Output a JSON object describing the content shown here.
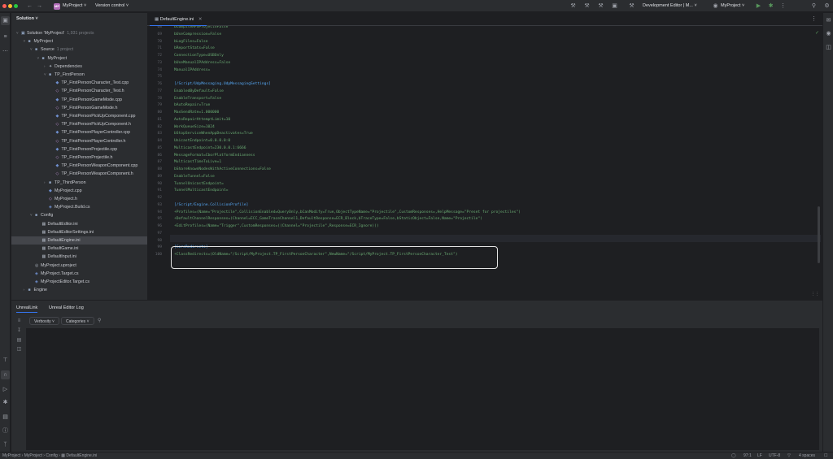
{
  "titlebar": {
    "project_badge": "MP",
    "project_name": "MyProject",
    "version_control": "Version control",
    "run_config": "Development Editor | M...",
    "target_project": "MyProject",
    "icons": [
      "back-icon",
      "forward-icon",
      "build-icon",
      "run-icon",
      "debug-icon",
      "more-icon",
      "search-icon",
      "settings-icon"
    ]
  },
  "solution": {
    "title": "Solution",
    "rows": [
      {
        "label": "Solution 'MyProject'",
        "hint": "1,931 projects",
        "depth": 0,
        "type": "sln",
        "expanded": true
      },
      {
        "label": "MyProject",
        "hint": "",
        "depth": 1,
        "type": "folder",
        "expanded": true
      },
      {
        "label": "Source",
        "hint": "1 project",
        "depth": 2,
        "type": "folder",
        "expanded": true
      },
      {
        "label": "MyProject",
        "hint": "",
        "depth": 3,
        "type": "folder",
        "expanded": true
      },
      {
        "label": "Dependencies",
        "hint": "",
        "depth": 4,
        "type": "deps",
        "expanded": false
      },
      {
        "label": "TP_FirstPerson",
        "hint": "",
        "depth": 4,
        "type": "folder",
        "expanded": true
      },
      {
        "label": "TP_FirstPersonCharacter_Test.cpp",
        "hint": "",
        "depth": 5,
        "type": "cpp"
      },
      {
        "label": "TP_FirstPersonCharacter_Test.h",
        "hint": "",
        "depth": 5,
        "type": "h"
      },
      {
        "label": "TP_FirstPersonGameMode.cpp",
        "hint": "",
        "depth": 5,
        "type": "cpp"
      },
      {
        "label": "TP_FirstPersonGameMode.h",
        "hint": "",
        "depth": 5,
        "type": "h"
      },
      {
        "label": "TP_FirstPersonPickUpComponent.cpp",
        "hint": "",
        "depth": 5,
        "type": "cpp"
      },
      {
        "label": "TP_FirstPersonPickUpComponent.h",
        "hint": "",
        "depth": 5,
        "type": "h"
      },
      {
        "label": "TP_FirstPersonPlayerController.cpp",
        "hint": "",
        "depth": 5,
        "type": "cpp"
      },
      {
        "label": "TP_FirstPersonPlayerController.h",
        "hint": "",
        "depth": 5,
        "type": "h"
      },
      {
        "label": "TP_FirstPersonProjectile.cpp",
        "hint": "",
        "depth": 5,
        "type": "cpp"
      },
      {
        "label": "TP_FirstPersonProjectile.h",
        "hint": "",
        "depth": 5,
        "type": "h"
      },
      {
        "label": "TP_FirstPersonWeaponComponent.cpp",
        "hint": "",
        "depth": 5,
        "type": "cpp"
      },
      {
        "label": "TP_FirstPersonWeaponComponent.h",
        "hint": "",
        "depth": 5,
        "type": "h"
      },
      {
        "label": "TP_ThirdPerson",
        "hint": "",
        "depth": 4,
        "type": "folder",
        "expanded": false
      },
      {
        "label": "MyProject.cpp",
        "hint": "",
        "depth": 4,
        "type": "cpp"
      },
      {
        "label": "MyProject.h",
        "hint": "",
        "depth": 4,
        "type": "h"
      },
      {
        "label": "MyProject.Build.cs",
        "hint": "",
        "depth": 4,
        "type": "cs"
      },
      {
        "label": "Config",
        "hint": "",
        "depth": 2,
        "type": "folder",
        "expanded": true
      },
      {
        "label": "DefaultEditor.ini",
        "hint": "",
        "depth": 3,
        "type": "ini"
      },
      {
        "label": "DefaultEditorSettings.ini",
        "hint": "",
        "depth": 3,
        "type": "ini"
      },
      {
        "label": "DefaultEngine.ini",
        "hint": "",
        "depth": 3,
        "type": "ini",
        "selected": true
      },
      {
        "label": "DefaultGame.ini",
        "hint": "",
        "depth": 3,
        "type": "ini"
      },
      {
        "label": "DefaultInput.ini",
        "hint": "",
        "depth": 3,
        "type": "ini"
      },
      {
        "label": "MyProject.uproject",
        "hint": "",
        "depth": 2,
        "type": "uproject"
      },
      {
        "label": "MyProject.Target.cs",
        "hint": "",
        "depth": 2,
        "type": "cs"
      },
      {
        "label": "MyProjectEditor.Target.cs",
        "hint": "",
        "depth": 2,
        "type": "cs"
      },
      {
        "label": "Engine",
        "hint": "",
        "depth": 1,
        "type": "folder",
        "expanded": false
      }
    ]
  },
  "editor": {
    "tab_label": "DefaultEngine.ini",
    "lines": [
      {
        "n": "68",
        "text": "bCompileAFSProject=False",
        "kind": "key"
      },
      {
        "n": "69",
        "text": "bUseCompression=False",
        "kind": "key"
      },
      {
        "n": "70",
        "text": "bLogFiles=False",
        "kind": "key"
      },
      {
        "n": "71",
        "text": "bReportStats=False",
        "kind": "key"
      },
      {
        "n": "72",
        "text": "ConnectionType=USBOnly",
        "kind": "key"
      },
      {
        "n": "73",
        "text": "bUseManualIPAddress=False",
        "kind": "key"
      },
      {
        "n": "74",
        "text": "ManualIPAddress=",
        "kind": "key"
      },
      {
        "n": "75",
        "text": "",
        "kind": "key"
      },
      {
        "n": "76",
        "text": "[/Script/UdpMessaging.UdpMessagingSettings]",
        "kind": "sec"
      },
      {
        "n": "77",
        "text": "EnabledByDefault=False",
        "kind": "key"
      },
      {
        "n": "78",
        "text": "EnableTransport=False",
        "kind": "key"
      },
      {
        "n": "79",
        "text": "bAutoRepair=True",
        "kind": "key"
      },
      {
        "n": "80",
        "text": "MaxSendRate=1.000000",
        "kind": "key"
      },
      {
        "n": "81",
        "text": "AutoRepairAttemptLimit=10",
        "kind": "key"
      },
      {
        "n": "82",
        "text": "WorkQueueSize=1024",
        "kind": "key"
      },
      {
        "n": "83",
        "text": "bStopServiceWhenAppDeactivates=True",
        "kind": "key"
      },
      {
        "n": "84",
        "text": "UnicastEndpoint=0.0.0.0:0",
        "kind": "key"
      },
      {
        "n": "85",
        "text": "MulticastEndpoint=230.0.0.1:6666",
        "kind": "key"
      },
      {
        "n": "86",
        "text": "MessageFormat=CborPlatformEndianness",
        "kind": "key"
      },
      {
        "n": "87",
        "text": "MulticastTimeToLive=1",
        "kind": "key"
      },
      {
        "n": "88",
        "text": "bShareKnownNodesWithActiveConnections=False",
        "kind": "key"
      },
      {
        "n": "89",
        "text": "EnableTunnel=False",
        "kind": "key"
      },
      {
        "n": "90",
        "text": "TunnelUnicastEndpoint=",
        "kind": "key"
      },
      {
        "n": "91",
        "text": "TunnelMulticastEndpoint=",
        "kind": "key"
      },
      {
        "n": "92",
        "text": "",
        "kind": "key"
      },
      {
        "n": "93",
        "text": "[/Script/Engine.CollisionProfile]",
        "kind": "sec"
      },
      {
        "n": "94",
        "text": "+Profiles=(Name=\"Projectile\",CollisionEnabled=QueryOnly,bCanModify=True,ObjectTypeName=\"Projectile\",CustomResponses=,HelpMessage=\"Preset for projectiles\")",
        "kind": "key"
      },
      {
        "n": "95",
        "text": "+DefaultChannelResponses=(Channel=ECC_GameTraceChannel1,DefaultResponse=ECR_Block,bTraceType=False,bStaticObject=False,Name=\"Projectile\")",
        "kind": "key"
      },
      {
        "n": "96",
        "text": "+EditProfiles=(Name=\"Trigger\",CustomResponses=((Channel=\"Projectile\",Response=ECR_Ignore)))",
        "kind": "key"
      },
      {
        "n": "97",
        "text": "",
        "kind": "key"
      },
      {
        "n": "98",
        "text": "",
        "kind": "key"
      },
      {
        "n": "99",
        "text": "[CoreRedirects]",
        "kind": "sec"
      },
      {
        "n": "100",
        "text": "+ClassRedirects=(OldName=\"/Script/MyProject.TP_FirstPersonCharacter\",NewName=\"/Script/MyProject.TP_FirstPersonCharacter_Test\")",
        "kind": "key"
      }
    ]
  },
  "bottom_panel": {
    "tabs": [
      "UnrealLink",
      "Unreal Editor Log"
    ],
    "filters": [
      "Verbosity",
      "Categories"
    ]
  },
  "statusbar": {
    "breadcrumb": [
      "MyProject",
      "MyProject",
      "Config",
      "DefaultEngine.ini"
    ],
    "position": "97:1",
    "line_ending": "LF",
    "encoding": "UTF-8",
    "indent": "4 spaces"
  }
}
